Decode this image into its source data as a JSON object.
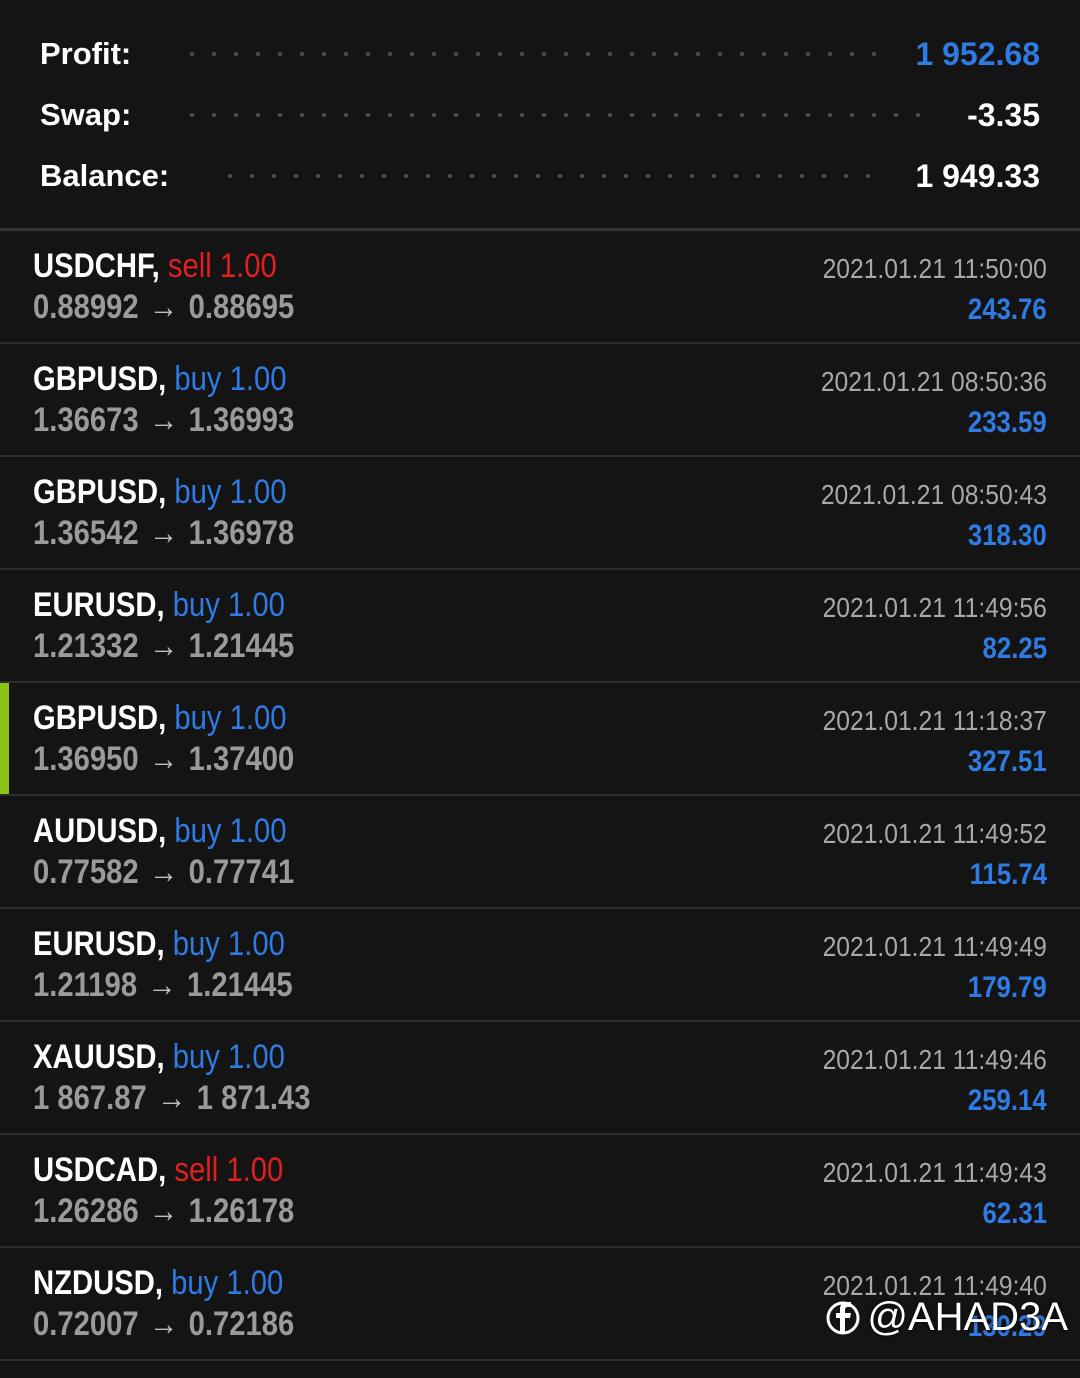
{
  "summary": {
    "profit_label": "Profit:",
    "profit_value": "1 952.68",
    "swap_label": "Swap:",
    "swap_value": "-3.35",
    "balance_label": "Balance:",
    "balance_value": "1 949.33"
  },
  "colors": {
    "profit_blue": "#2f7be4",
    "sell_red": "#e0201e",
    "buy_blue": "#2f7be4",
    "selected_marker": "#8cc21a",
    "background": "#141414"
  },
  "trades": [
    {
      "symbol": "USDCHF,",
      "side": "sell",
      "volume": "1.00",
      "open": "0.88992",
      "arrow": "→",
      "close": "0.88695",
      "time": "2021.01.21 11:50:00",
      "profit": "243.76",
      "selected": false
    },
    {
      "symbol": "GBPUSD,",
      "side": "buy",
      "volume": "1.00",
      "open": "1.36673",
      "arrow": "→",
      "close": "1.36993",
      "time": "2021.01.21 08:50:36",
      "profit": "233.59",
      "selected": false
    },
    {
      "symbol": "GBPUSD,",
      "side": "buy",
      "volume": "1.00",
      "open": "1.36542",
      "arrow": "→",
      "close": "1.36978",
      "time": "2021.01.21 08:50:43",
      "profit": "318.30",
      "selected": false
    },
    {
      "symbol": "EURUSD,",
      "side": "buy",
      "volume": "1.00",
      "open": "1.21332",
      "arrow": "→",
      "close": "1.21445",
      "time": "2021.01.21 11:49:56",
      "profit": "82.25",
      "selected": false
    },
    {
      "symbol": "GBPUSD,",
      "side": "buy",
      "volume": "1.00",
      "open": "1.36950",
      "arrow": "→",
      "close": "1.37400",
      "time": "2021.01.21 11:18:37",
      "profit": "327.51",
      "selected": true
    },
    {
      "symbol": "AUDUSD,",
      "side": "buy",
      "volume": "1.00",
      "open": "0.77582",
      "arrow": "→",
      "close": "0.77741",
      "time": "2021.01.21 11:49:52",
      "profit": "115.74",
      "selected": false
    },
    {
      "symbol": "EURUSD,",
      "side": "buy",
      "volume": "1.00",
      "open": "1.21198",
      "arrow": "→",
      "close": "1.21445",
      "time": "2021.01.21 11:49:49",
      "profit": "179.79",
      "selected": false
    },
    {
      "symbol": "XAUUSD,",
      "side": "buy",
      "volume": "1.00",
      "open": "1 867.87",
      "arrow": "→",
      "close": "1 871.43",
      "time": "2021.01.21 11:49:46",
      "profit": "259.14",
      "selected": false
    },
    {
      "symbol": "USDCAD,",
      "side": "sell",
      "volume": "1.00",
      "open": "1.26286",
      "arrow": "→",
      "close": "1.26178",
      "time": "2021.01.21 11:49:43",
      "profit": "62.31",
      "selected": false
    },
    {
      "symbol": "NZDUSD,",
      "side": "buy",
      "volume": "1.00",
      "open": "0.72007",
      "arrow": "→",
      "close": "0.72186",
      "time": "2021.01.21 11:49:40",
      "profit": "130.29",
      "selected": false
    }
  ],
  "watermark": {
    "icon": "facebook-icon",
    "text": "@AHAD3A"
  }
}
